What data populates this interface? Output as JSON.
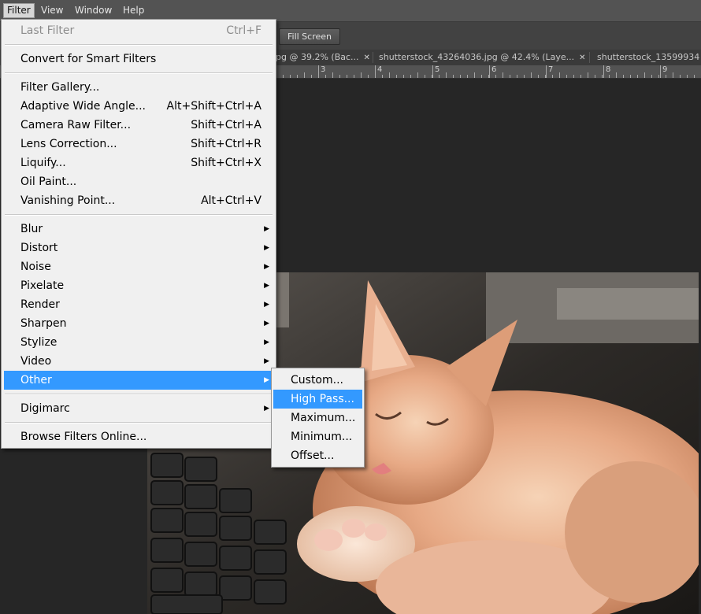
{
  "menubar": {
    "items": [
      "Filter",
      "View",
      "Window",
      "Help"
    ],
    "active": "Filter"
  },
  "options_bar": {
    "fill_screen_label": "Fill Screen"
  },
  "tabs": [
    {
      "label": "pg @ 39.2% (Bac..."
    },
    {
      "label": "shutterstock_43264036.jpg @ 42.4% (Laye..."
    },
    {
      "label": "shutterstock_13599934"
    }
  ],
  "ruler": {
    "numbers": [
      "3",
      "4",
      "5",
      "6",
      "7",
      "8",
      "9"
    ]
  },
  "filter_menu": {
    "groups": [
      [
        {
          "label": "Last Filter",
          "shortcut": "Ctrl+F",
          "disabled": true
        }
      ],
      [
        {
          "label": "Convert for Smart Filters",
          "shortcut": ""
        }
      ],
      [
        {
          "label": "Filter Gallery...",
          "shortcut": ""
        },
        {
          "label": "Adaptive Wide Angle...",
          "shortcut": "Alt+Shift+Ctrl+A"
        },
        {
          "label": "Camera Raw Filter...",
          "shortcut": "Shift+Ctrl+A"
        },
        {
          "label": "Lens Correction...",
          "shortcut": "Shift+Ctrl+R"
        },
        {
          "label": "Liquify...",
          "shortcut": "Shift+Ctrl+X"
        },
        {
          "label": "Oil Paint...",
          "shortcut": ""
        },
        {
          "label": "Vanishing Point...",
          "shortcut": "Alt+Ctrl+V"
        }
      ],
      [
        {
          "label": "Blur",
          "submenu": true
        },
        {
          "label": "Distort",
          "submenu": true
        },
        {
          "label": "Noise",
          "submenu": true
        },
        {
          "label": "Pixelate",
          "submenu": true
        },
        {
          "label": "Render",
          "submenu": true
        },
        {
          "label": "Sharpen",
          "submenu": true
        },
        {
          "label": "Stylize",
          "submenu": true
        },
        {
          "label": "Video",
          "submenu": true
        },
        {
          "label": "Other",
          "submenu": true,
          "highlighted": true
        }
      ],
      [
        {
          "label": "Digimarc",
          "submenu": true
        }
      ],
      [
        {
          "label": "Browse Filters Online...",
          "shortcut": ""
        }
      ]
    ]
  },
  "other_submenu": {
    "items": [
      {
        "label": "Custom..."
      },
      {
        "label": "High Pass...",
        "highlighted": true
      },
      {
        "label": "Maximum..."
      },
      {
        "label": "Minimum..."
      },
      {
        "label": "Offset..."
      }
    ]
  },
  "colors": {
    "highlight": "#3399ff",
    "menu_bg": "#f0f0f0",
    "workspace": "#262626"
  },
  "icons": {
    "submenu_arrow": "chevron-right-icon",
    "tab_close": "close-icon"
  }
}
